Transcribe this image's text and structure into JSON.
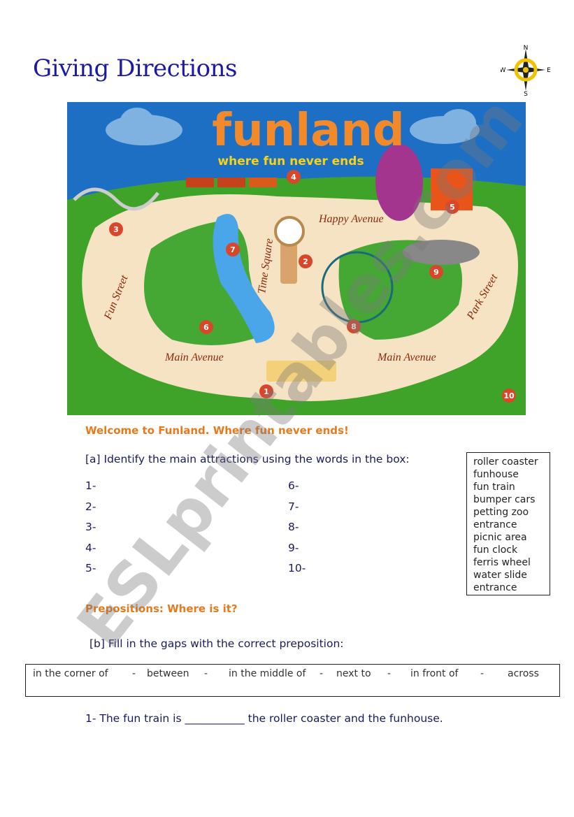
{
  "header": {
    "title": "Giving Directions",
    "compass": {
      "n": "N",
      "s": "S",
      "e": "E",
      "w": "W"
    }
  },
  "map": {
    "logo": "funland",
    "slogan": "where fun never ends",
    "streets": [
      "Fun Street",
      "Time Square",
      "Happy Avenue",
      "Main Avenue",
      "Main Avenue",
      "Park Street"
    ],
    "markers": [
      "1",
      "2",
      "3",
      "4",
      "5",
      "6",
      "7",
      "8",
      "9",
      "10"
    ],
    "colors": {
      "sky": "#1d6fc4",
      "grass": "#3fa32a",
      "path": "#f6e3c4",
      "marker": "#d9472b",
      "street_text": "#8a2a0a"
    }
  },
  "section_a": {
    "welcome": "Welcome to Funland. Where fun never ends!",
    "instruction": "[a] Identify the main attractions using the words in the box:",
    "left_numbers": [
      "1-",
      "2-",
      "3-",
      "4-",
      "5-"
    ],
    "right_numbers": [
      "6-",
      "7-",
      "8-",
      "9-",
      "10-"
    ],
    "word_box": [
      "roller coaster",
      "funhouse",
      "fun train",
      "bumper cars",
      "petting zoo",
      "entrance",
      "picnic area",
      "fun clock",
      "ferris wheel",
      "water slide",
      "entrance"
    ]
  },
  "section_b": {
    "heading": "Prepositions: Where is it?",
    "instruction": "[b] Fill in the gaps with the correct preposition:",
    "prepositions": [
      "in the corner of",
      "-",
      "between",
      "-",
      "in the middle of",
      "-",
      "next to",
      "-",
      "in front of",
      "-",
      "across"
    ],
    "sentence_1": "1- The fun train is ___________ the roller coaster and the funhouse."
  },
  "watermark": "ESLprintables.com"
}
